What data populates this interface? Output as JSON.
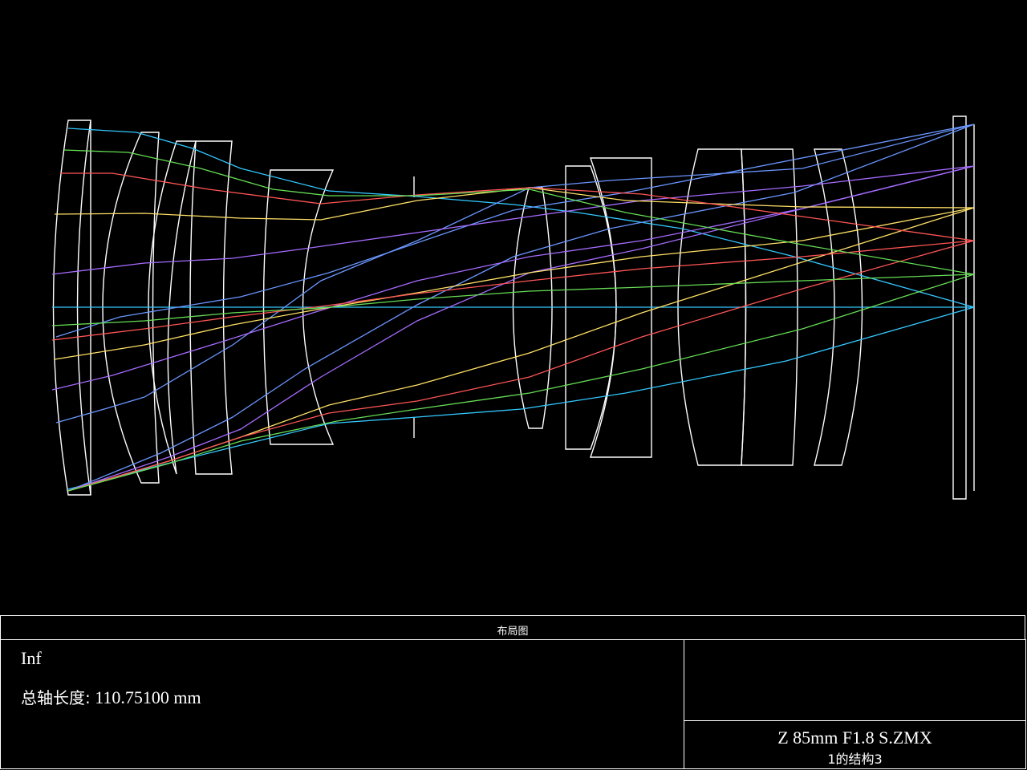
{
  "window": {
    "title": "布局图"
  },
  "info": {
    "object_distance": "Inf",
    "total_length_label": "总轴长度:",
    "total_length_value": "110.75100 mm"
  },
  "file": {
    "name": "Z 85mm F1.8 S.ZMX",
    "configuration": "1的结构3"
  },
  "colors": {
    "background": "#000000",
    "lens_outline": "#ffffff",
    "field_1": "#33c8ff",
    "field_2": "#6a96ff",
    "field_3": "#a66bff",
    "field_4": "#ffe066",
    "field_5": "#ff5555",
    "field_6": "#66dd55"
  },
  "icons": [
    "aperture-stop-marker"
  ]
}
